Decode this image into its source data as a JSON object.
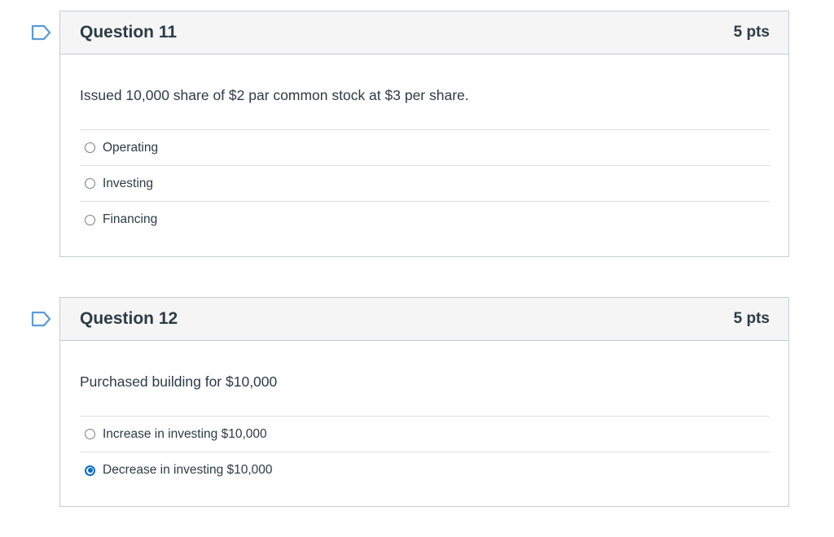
{
  "questions": [
    {
      "title": "Question 11",
      "points": "5 pts",
      "text": "Issued 10,000 share of $2 par common stock at $3 per share.",
      "answers": [
        {
          "label": "Operating",
          "selected": false
        },
        {
          "label": "Investing",
          "selected": false
        },
        {
          "label": "Financing",
          "selected": false
        }
      ]
    },
    {
      "title": "Question 12",
      "points": "5 pts",
      "text": "Purchased building for $10,000",
      "answers": [
        {
          "label": "Increase in investing $10,000",
          "selected": false
        },
        {
          "label": "Decrease in investing $10,000",
          "selected": true
        }
      ]
    }
  ],
  "colors": {
    "flag_outline": "#5b9bd5",
    "radio_selected": "#0b6bcb",
    "header_bg": "#f5f5f5",
    "border": "#c7cdd1"
  },
  "icons": {
    "flag": "bookmark-flag-icon"
  }
}
